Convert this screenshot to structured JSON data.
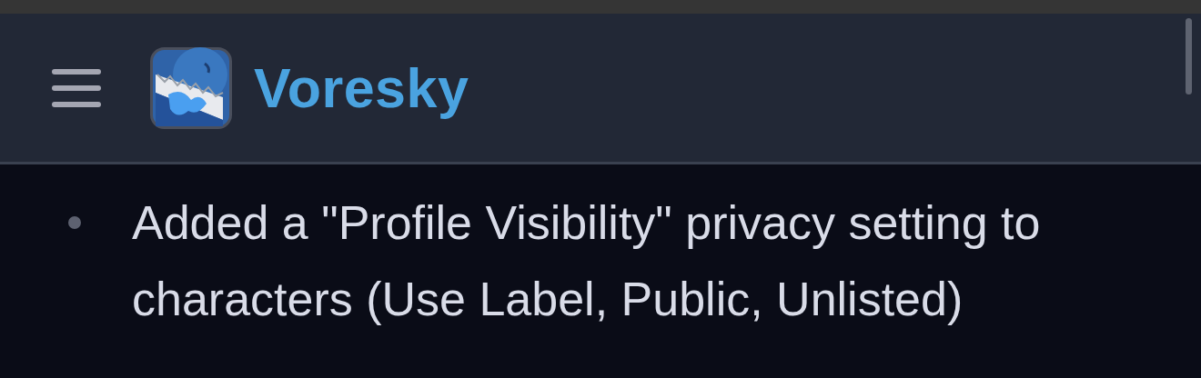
{
  "header": {
    "title": "Voresky"
  },
  "changelog": [
    {
      "text": "Added a \"Profile Visibility\" privacy setting to characters (Use Label, Public, Unlisted)"
    }
  ]
}
